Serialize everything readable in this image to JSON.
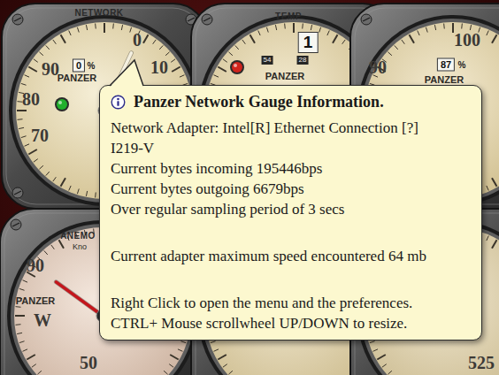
{
  "gauges": [
    {
      "labels": [
        {
          "text": "NETWORK",
          "kind": "title"
        },
        {
          "text": "0",
          "kind": "scale"
        },
        {
          "text": "10",
          "kind": "scale"
        },
        {
          "text": "90",
          "kind": "scale"
        },
        {
          "text": "80",
          "kind": "scale"
        },
        {
          "text": "70",
          "kind": "scale"
        },
        {
          "text": "0",
          "kind": "digit"
        },
        {
          "text": "%",
          "kind": "unit"
        },
        {
          "text": "PANZER",
          "kind": "brand"
        }
      ],
      "lamp": {
        "color": "#22b02c"
      },
      "needle": {
        "level": 0,
        "color": "#f4f0e0"
      }
    },
    {
      "labels": [
        {
          "text": "TEMP",
          "kind": "title"
        },
        {
          "text": "1",
          "kind": "digit-large"
        },
        {
          "text": "54",
          "kind": "small-digit"
        },
        {
          "text": "28",
          "kind": "small-digit"
        },
        {
          "text": "PANZER",
          "kind": "brand"
        }
      ],
      "lamp": {
        "color": "#d0241c"
      }
    },
    {
      "labels": [
        {
          "text": "100",
          "kind": "scale"
        },
        {
          "text": "90",
          "kind": "scale"
        },
        {
          "text": "87",
          "kind": "digit"
        },
        {
          "text": "%",
          "kind": "unit"
        },
        {
          "text": "PANZER",
          "kind": "brand"
        }
      ]
    },
    {
      "labels": [
        {
          "text": "ANEMO",
          "kind": "title"
        },
        {
          "text": "Kno",
          "kind": "small"
        },
        {
          "text": "90",
          "kind": "scale"
        },
        {
          "text": "PANZER",
          "kind": "brand"
        },
        {
          "text": "W",
          "kind": "scale"
        },
        {
          "text": "50",
          "kind": "scale"
        }
      ],
      "needle": {
        "level": 0.32,
        "color": "#c4161c"
      }
    },
    {
      "labels": []
    },
    {
      "labels": [
        {
          "text": "525",
          "kind": "scale"
        }
      ]
    }
  ],
  "tooltip": {
    "title": "Panzer Network Gauge Information.",
    "paragraphs": [
      [
        "Network Adapter: Intel[R] Ethernet Connection [?]",
        "I219-V",
        "Current bytes incoming 195446bps",
        "Current bytes outgoing 6679bps",
        "Over regular sampling period of 3 secs"
      ],
      [
        "Current adapter maximum speed encountered 64 mb"
      ],
      [
        "Right Click to open the menu and the preferences.",
        "CTRL+ Mouse scrollwheel UP/DOWN to resize."
      ]
    ]
  }
}
